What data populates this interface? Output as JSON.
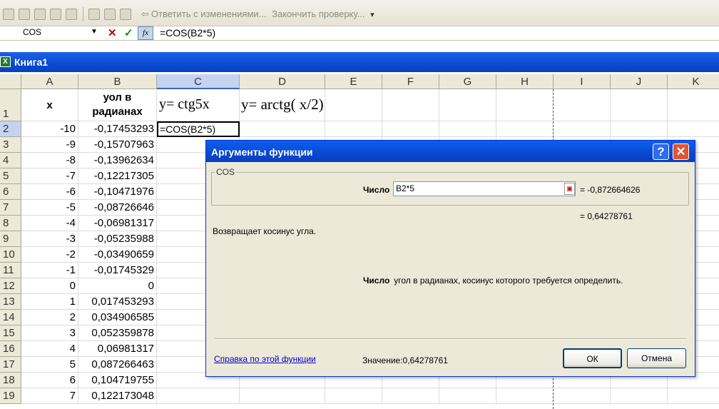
{
  "toolbar": {
    "reply_label": "Ответить с изменениями...",
    "end_review_label": "Закончить проверку...",
    "dropdown_glyph": "▾"
  },
  "formula_bar": {
    "name_box": "COS",
    "cancel_glyph": "✕",
    "enter_glyph": "✓",
    "fx_label": "fx",
    "formula": "=COS(B2*5)"
  },
  "window": {
    "title": "Книга1",
    "icon": "excel-workbook-icon"
  },
  "grid": {
    "columns": [
      "A",
      "B",
      "C",
      "D",
      "E",
      "F",
      "G",
      "H",
      "I",
      "J",
      "K"
    ],
    "selected_column": "C",
    "header_row": {
      "row": "1",
      "a": "x",
      "b_line1": "уол в",
      "b_line2": "радианах",
      "c": "y= ctg5x",
      "d": "y= arctg( x/2)"
    },
    "active_cell": "=COS(B2*5)",
    "rows": [
      {
        "row": "2",
        "a": "-10",
        "b": "-0,17453293"
      },
      {
        "row": "3",
        "a": "-9",
        "b": "-0,15707963"
      },
      {
        "row": "4",
        "a": "-8",
        "b": "-0,13962634"
      },
      {
        "row": "5",
        "a": "-7",
        "b": "-0,12217305"
      },
      {
        "row": "6",
        "a": "-6",
        "b": "-0,10471976"
      },
      {
        "row": "7",
        "a": "-5",
        "b": "-0,08726646"
      },
      {
        "row": "8",
        "a": "-4",
        "b": "-0,06981317"
      },
      {
        "row": "9",
        "a": "-3",
        "b": "-0,05235988"
      },
      {
        "row": "10",
        "a": "-2",
        "b": "-0,03490659"
      },
      {
        "row": "11",
        "a": "-1",
        "b": "-0,01745329"
      },
      {
        "row": "12",
        "a": "0",
        "b": "0"
      },
      {
        "row": "13",
        "a": "1",
        "b": "0,017453293"
      },
      {
        "row": "14",
        "a": "2",
        "b": "0,034906585"
      },
      {
        "row": "15",
        "a": "3",
        "b": "0,052359878"
      },
      {
        "row": "16",
        "a": "4",
        "b": "0,06981317"
      },
      {
        "row": "17",
        "a": "5",
        "b": "0,087266463"
      },
      {
        "row": "18",
        "a": "6",
        "b": "0,104719755"
      },
      {
        "row": "19",
        "a": "7",
        "b": "0,122173048"
      }
    ]
  },
  "dialog": {
    "title": "Аргументы функции",
    "help_glyph": "?",
    "close_glyph": "✕",
    "function_name": "COS",
    "arg_label": "Число",
    "arg_value": "B2*5",
    "arg_result": "= -0,872664626",
    "function_result": "= 0,64278761",
    "description": "Возвращает косинус угла.",
    "arg_desc_label": "Число",
    "arg_desc_text": "угол в радианах, косинус которого требуется определить.",
    "help_link": "Справка по этой функции",
    "value_text": "Значение:0,64278761",
    "ok_label": "ОК",
    "cancel_label": "Отмена"
  }
}
